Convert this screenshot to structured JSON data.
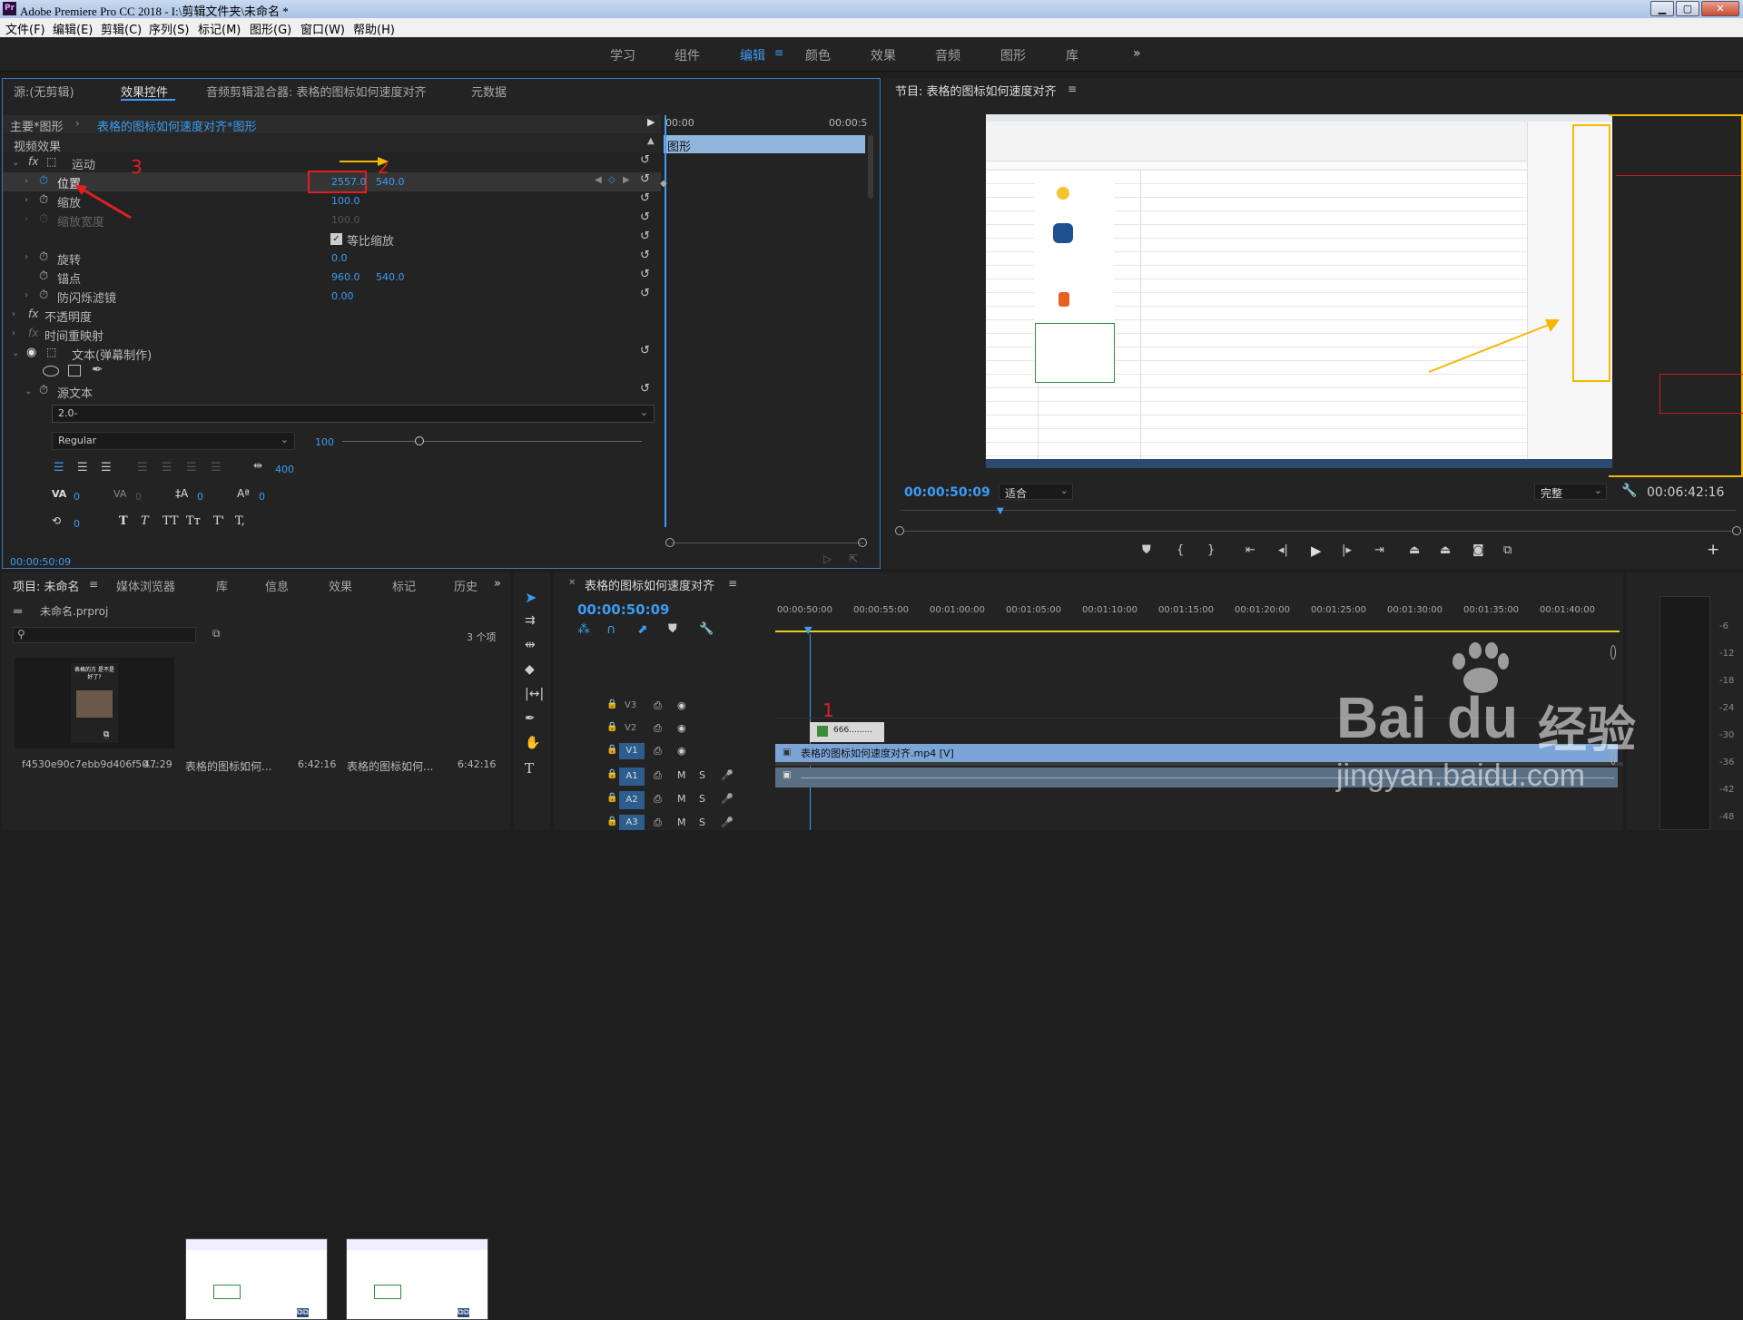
{
  "titlebar": {
    "title": "Adobe Premiere Pro CC 2018 - I:\\剪辑文件夹\\未命名 *",
    "min": "▁",
    "max": "▢",
    "close": "✕"
  },
  "menu": [
    "文件(F)",
    "编辑(E)",
    "剪辑(C)",
    "序列(S)",
    "标记(M)",
    "图形(G)",
    "窗口(W)",
    "帮助(H)"
  ],
  "workspaces": [
    "学习",
    "组件",
    "编辑",
    "颜色",
    "效果",
    "音频",
    "图形",
    "库"
  ],
  "workspace_more": "»",
  "source_panel": {
    "tabs": [
      "源:(无剪辑)",
      "效果控件",
      "音频剪辑混合器: 表格的图标如何速度对齐",
      "元数据"
    ],
    "clip_label": "主要*图形",
    "clip_link": "表格的图标如何速度对齐*图形",
    "time_start": "00:00",
    "time_end": "00:00:5",
    "graphic_label": "图形",
    "video_effects": "视频效果",
    "motion": "运动",
    "position": {
      "label": "位置",
      "x": "2557.0",
      "y": "540.0"
    },
    "scale": {
      "label": "缩放",
      "value": "100.0"
    },
    "scale_width": {
      "label": "缩放宽度",
      "value": "100.0"
    },
    "uniform_scale": "等比缩放",
    "rotation": {
      "label": "旋转",
      "value": "0.0"
    },
    "anchor": {
      "label": "锚点",
      "x": "960.0",
      "y": "540.0"
    },
    "antiflicker": {
      "label": "防闪烁滤镜",
      "value": "0.00"
    },
    "opacity": "不透明度",
    "time_remap": "时间重映射",
    "text_layer": "文本(弹幕制作)",
    "source_text": "源文本",
    "font_name": "2.0-",
    "font_style": "Regular",
    "font_size": "100",
    "tracking": "400",
    "kerning": "0",
    "tsume": "0",
    "leading": "0",
    "baseline": "0",
    "rotate_text": "0",
    "styles": [
      "T",
      "T",
      "TT",
      "Tт",
      "T'",
      "T,"
    ],
    "timecode": "00:00:50:09"
  },
  "annotations": {
    "n1": "1",
    "n2": "2",
    "n3": "3"
  },
  "program": {
    "title": "节目: 表格的图标如何速度对齐",
    "timecode": "00:00:50:09",
    "fit": "适合",
    "quality": "完整",
    "duration": "00:06:42:16"
  },
  "project": {
    "tabs": [
      "项目: 未命名",
      "媒体浏览器",
      "库",
      "信息",
      "效果",
      "标记",
      "历史"
    ],
    "file": "未命名.prproj",
    "count": "3 个项",
    "items": [
      {
        "name": "f4530e90c7ebb9d406f50...",
        "dur": "47:29",
        "thumb_text": "表格的方 是不是好了?"
      },
      {
        "name": "表格的图标如何...",
        "dur": "6:42:16"
      },
      {
        "name": "表格的图标如何...",
        "dur": "6:42:16"
      }
    ]
  },
  "timeline": {
    "title": "表格的图标如何速度对齐",
    "timecode": "00:00:50:09",
    "ticks": [
      "00:00:50:00",
      "00:00:55:00",
      "00:01:00:00",
      "00:01:05:00",
      "00:01:10:00",
      "00:01:15:00",
      "00:01:20:00",
      "00:01:25:00",
      "00:01:30:00",
      "00:01:35:00",
      "00:01:40:00"
    ],
    "tracks": [
      "V3",
      "V2",
      "V1",
      "A1",
      "A2",
      "A3"
    ],
    "clip_v2": "666.........",
    "clip_v1": "表格的图标如何速度对齐.mp4 [V]"
  },
  "meters": [
    "-6",
    "-12",
    "-18",
    "-24",
    "-30",
    "-36",
    "-42",
    "-48"
  ],
  "watermark": {
    "brand": "Bai",
    "brand2": "du",
    "cn": "经验",
    "url": "jingyan.baidu.com"
  },
  "colors": {
    "accent": "#3b9cf2",
    "annotation": "#e02020",
    "arrow": "#f5b800",
    "clip_v1": "#7ba5d6"
  }
}
